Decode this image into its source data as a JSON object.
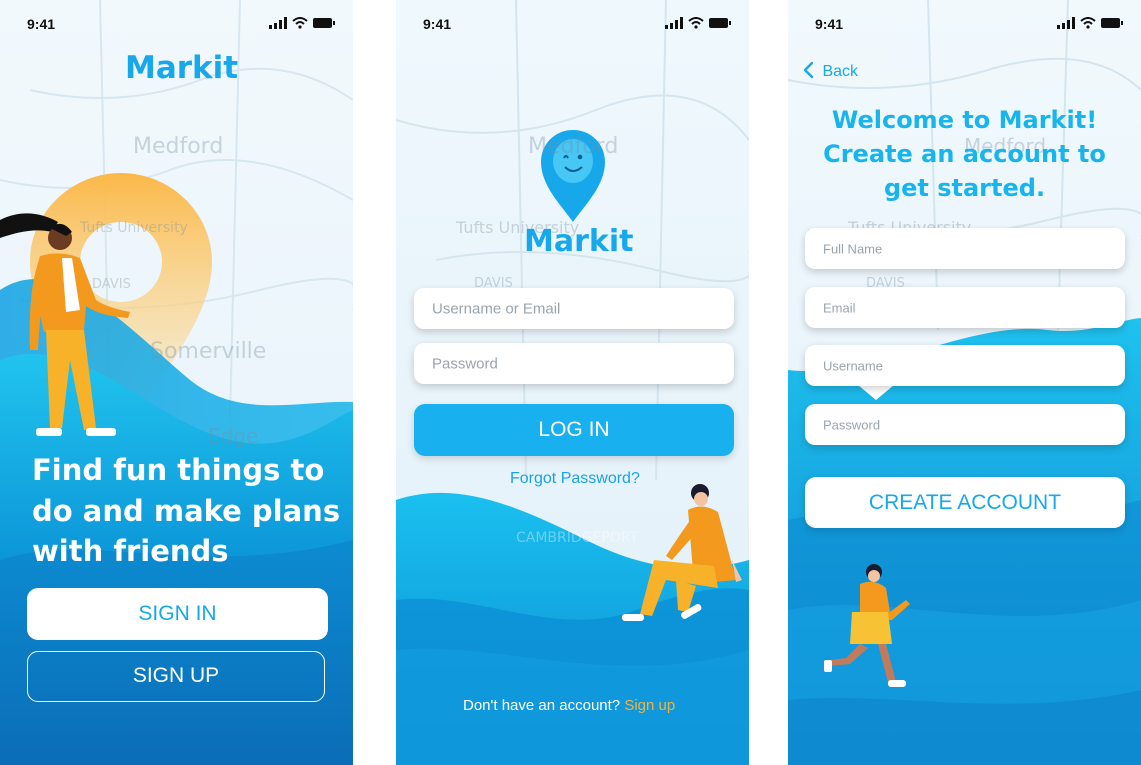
{
  "status": {
    "time": "9:41"
  },
  "screen1": {
    "brand": "Markit",
    "map_labels": [
      "Medford",
      "Tufts University",
      "DAVIS",
      "Somerville",
      "Edge"
    ],
    "headline": [
      "Find fun things to",
      "do and make plans",
      "with friends"
    ],
    "sign_in_label": "SIGN IN",
    "sign_up_label": "SIGN UP"
  },
  "screen2": {
    "brand": "Markit",
    "map_labels": [
      "Medford",
      "Tufts University",
      "DAVIS",
      "CAMBRIDGEPORT"
    ],
    "username_placeholder": "Username or Email",
    "password_placeholder": "Password",
    "login_label": "LOG IN",
    "forgot_label": "Forgot Password?",
    "signup_prompt": "Don't have an account?",
    "signup_link": "Sign up"
  },
  "screen3": {
    "back_label": "Back",
    "map_labels": [
      "Medford",
      "Tufts University",
      "DAVIS"
    ],
    "headline": [
      "Welcome to Markit!",
      "Create an account to",
      "get started."
    ],
    "fullname_placeholder": "Full Name",
    "email_placeholder": "Email",
    "username_placeholder": "Username",
    "password_placeholder": "Password",
    "create_label": "CREATE ACCOUNT"
  },
  "colors": {
    "brand_blue": "#17a8ec",
    "accent_yellow": "#f2b43c",
    "figure_orange": "#f39a1e"
  }
}
